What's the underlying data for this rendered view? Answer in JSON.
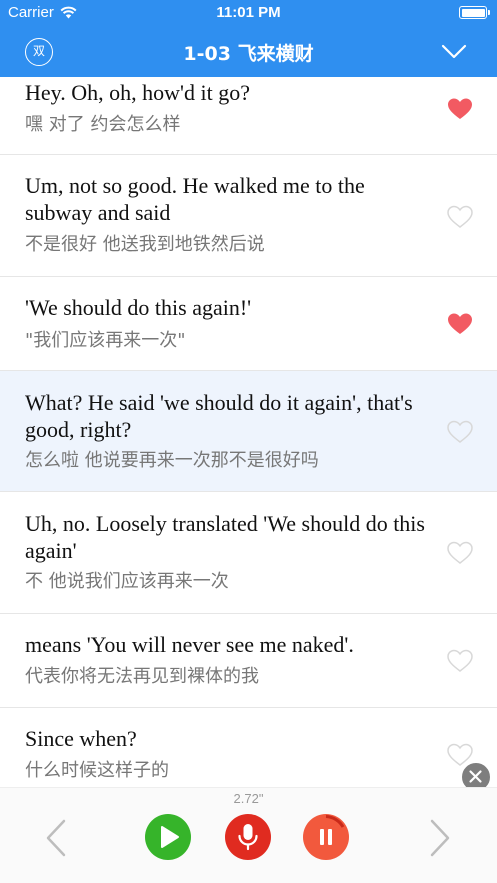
{
  "status_bar": {
    "carrier": "Carrier",
    "time": "11:01 PM",
    "wifi_icon": "wifi-icon",
    "battery_icon": "battery-icon"
  },
  "nav": {
    "mode_label": "双",
    "title": "1-03 飞来横财",
    "dropdown_icon": "chevron-down-icon"
  },
  "dialogue": [
    {
      "en": "Hey. Oh, oh, how'd it go?",
      "zh": "嘿 对了 约会怎么样",
      "favorited": true
    },
    {
      "en": "Um, not so good. He walked me to the subway and said",
      "zh": "不是很好 他送我到地铁然后说",
      "favorited": false
    },
    {
      "en": "'We should do this again!'",
      "zh": "\"我们应该再来一次\"",
      "favorited": true
    },
    {
      "en": "What? He said 'we should do it again', that's good, right?",
      "zh": "怎么啦 他说要再来一次那不是很好吗",
      "favorited": false
    },
    {
      "en": "Uh, no. Loosely translated 'We should do this again'",
      "zh": "不 他说我们应该再来一次",
      "favorited": false
    },
    {
      "en": "means 'You will never see me naked'.",
      "zh": "代表你将无法再见到裸体的我",
      "favorited": false
    },
    {
      "en": "Since when?",
      "zh": "什么时候这样子的",
      "favorited": false
    }
  ],
  "controls": {
    "duration": "2.72\"",
    "prev_icon": "chevron-left-icon",
    "play_icon": "play-icon",
    "mic_icon": "microphone-icon",
    "pause_icon": "pause-icon",
    "next_icon": "chevron-right-icon",
    "close_icon": "close-icon"
  },
  "colors": {
    "primary": "#2f8ff0",
    "heart": "#f25a62",
    "active_row": "#eef4fd",
    "play": "#36b42a",
    "record": "#e02b20",
    "pause": "#f2593d"
  }
}
